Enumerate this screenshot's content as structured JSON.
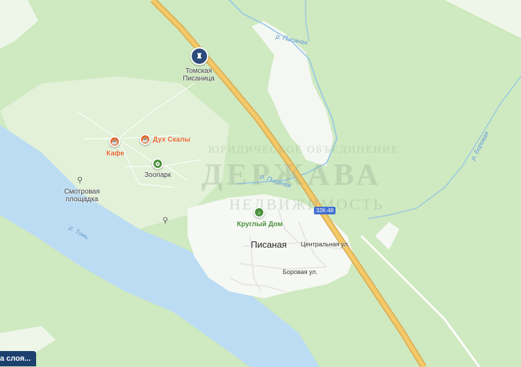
{
  "labels": {
    "monument": "Томская\nПисаница",
    "cafe": "Кафе",
    "spirit": "Дух Скалы",
    "zoo": "Зоопарк",
    "viewpoint": "Смотровая\nплощадка",
    "round_house": "Круглый Дом",
    "village": "Писаная",
    "street_central": "Центральная ул.",
    "street_borovaya": "Боровая ул.",
    "river_pisanaya_1": "р. Писаная",
    "river_pisanaya_2": "р. Писаная",
    "river_tom": "р. Томь",
    "river_borovaya": "р. Боровая",
    "road_shield": "32К-48"
  },
  "watermark": {
    "line1": "ЮРИДИЧЕСКОЕ ОБЪЕДИНЕНИЕ",
    "line2": "ДЕРЖАВА",
    "line3": "НЕДВИЖИМОСТЬ"
  },
  "layers_button": "а слоя...",
  "colors": {
    "forest": "#cfe9c0",
    "meadow": "#e2f1d8",
    "water": "#bcdcf4",
    "river_line": "#8ec3ea",
    "road": "#f3c96a",
    "settlement": "#f6f8f4",
    "accent_orange": "#e0672a",
    "accent_green": "#4a8f3a"
  },
  "icons": {
    "monument": "monument-icon",
    "cafe": "cup-icon",
    "spirit": "cup-icon",
    "zoo": "paw-icon",
    "viewpoint": "binoculars-icon",
    "round_house": "house-icon"
  }
}
